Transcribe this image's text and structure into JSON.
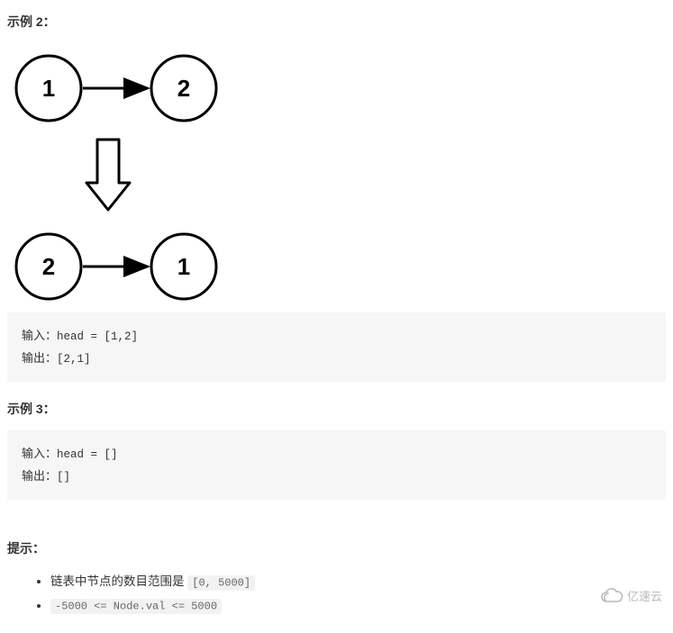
{
  "example2": {
    "heading": "示例 2：",
    "diagram": {
      "top": [
        "1",
        "2"
      ],
      "bottom": [
        "2",
        "1"
      ]
    },
    "input_label": "输入：",
    "input_code": "head = [1,2]",
    "output_label": "输出：",
    "output_code": "[2,1]"
  },
  "example3": {
    "heading": "示例 3：",
    "input_label": "输入：",
    "input_code": "head = []",
    "output_label": "输出：",
    "output_code": "[]"
  },
  "hints": {
    "title": "提示：",
    "item1_text": "链表中节点的数目范围是 ",
    "item1_code": "[0, 5000]",
    "item2_code": "-5000 <= Node.val <= 5000"
  },
  "watermark": "亿速云"
}
